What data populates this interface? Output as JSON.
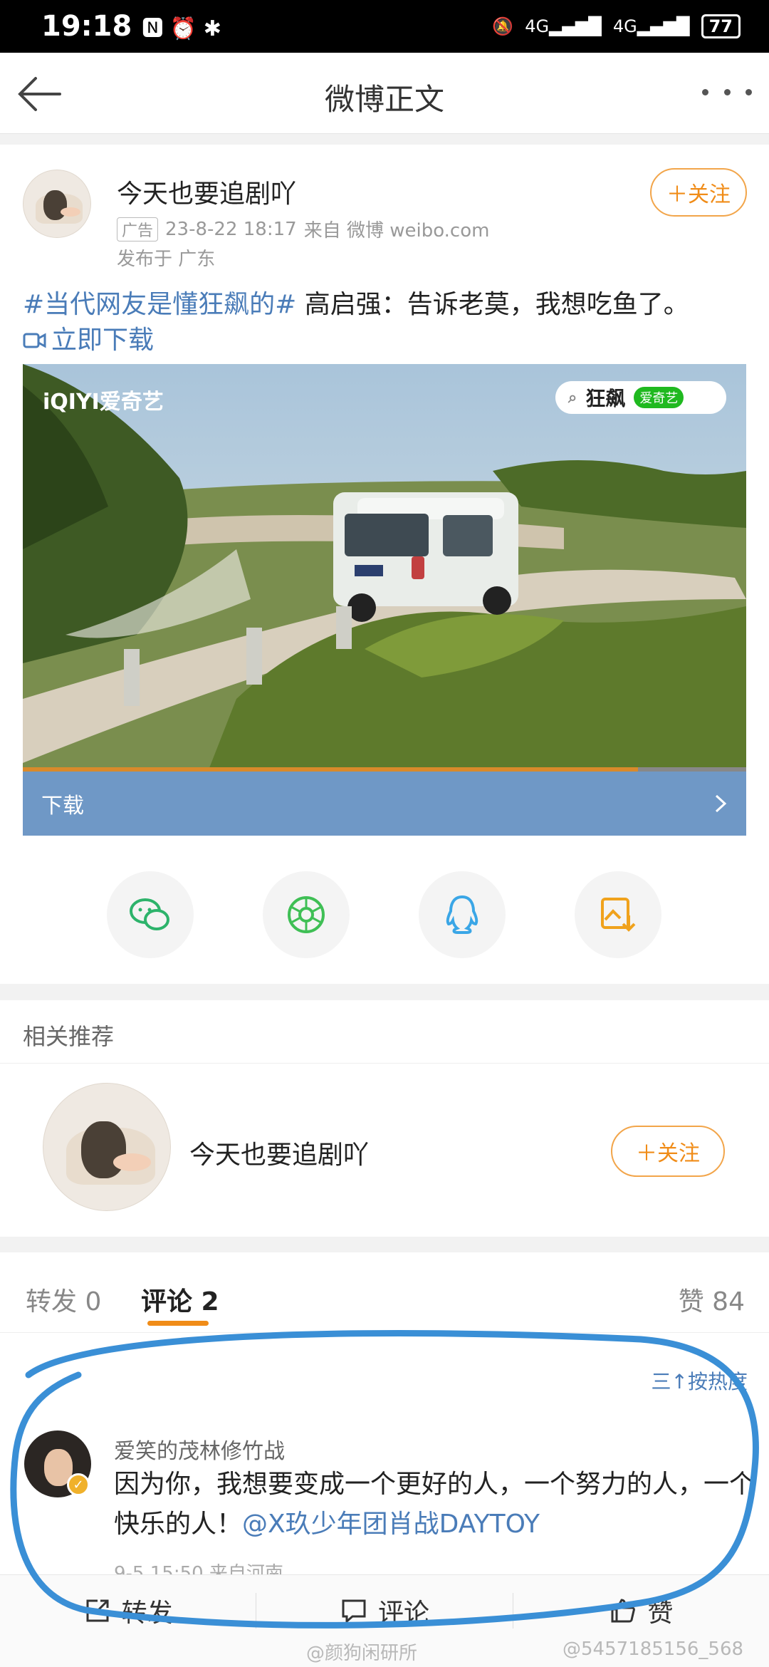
{
  "status_bar": {
    "time": "19:18",
    "left_icons": "🅽 ⏰ ✱",
    "signal1": "4G",
    "signal2": "4G",
    "battery": "77"
  },
  "nav": {
    "title": "微博正文"
  },
  "post": {
    "username": "今天也要追剧吖",
    "ad_label": "广告",
    "datetime": "23-8-22 18:17",
    "source": "来自 微博 weibo.com",
    "location": "发布于 广东",
    "follow_label": "＋关注",
    "hashtag": "#当代网友是懂狂飙的#",
    "text": " 高启强：告诉老莫，我想吃鱼了。",
    "download_link": "立即下载",
    "video": {
      "logo": "iQIYI爱奇艺",
      "search_text": "狂飙",
      "search_badge": "爱奇艺",
      "progress": 0.85,
      "bar_label": "下载"
    }
  },
  "share": [
    "wechat-icon",
    "moments-icon",
    "qq-icon",
    "save-image-icon"
  ],
  "related": {
    "title": "相关推荐",
    "username": "今天也要追剧吖",
    "follow_label": "＋关注"
  },
  "tabs": {
    "repost": "转发 0",
    "comment": "评论 2",
    "like": "赞 84"
  },
  "comments": {
    "sort_label": "三↑按热度",
    "items": [
      {
        "user": "爱笑的茂林修竹战",
        "text": "因为你，我想要变成一个更好的人，一个努力的人，一个快乐的人！",
        "mention": "@X玖少年团肖战DAYTOY",
        "meta": "9-5 15:50 来自河南"
      }
    ]
  },
  "bottom_bar": {
    "repost": "转发",
    "comment": "评论",
    "like": "赞"
  },
  "watermarks": {
    "left": "@颜狗闲研所",
    "right": "@5457185156_568"
  },
  "colors": {
    "accent": "#f08c18",
    "link": "#4a7cb8",
    "annotation": "#3a8fd6",
    "download_bar": "#6f98c6"
  }
}
